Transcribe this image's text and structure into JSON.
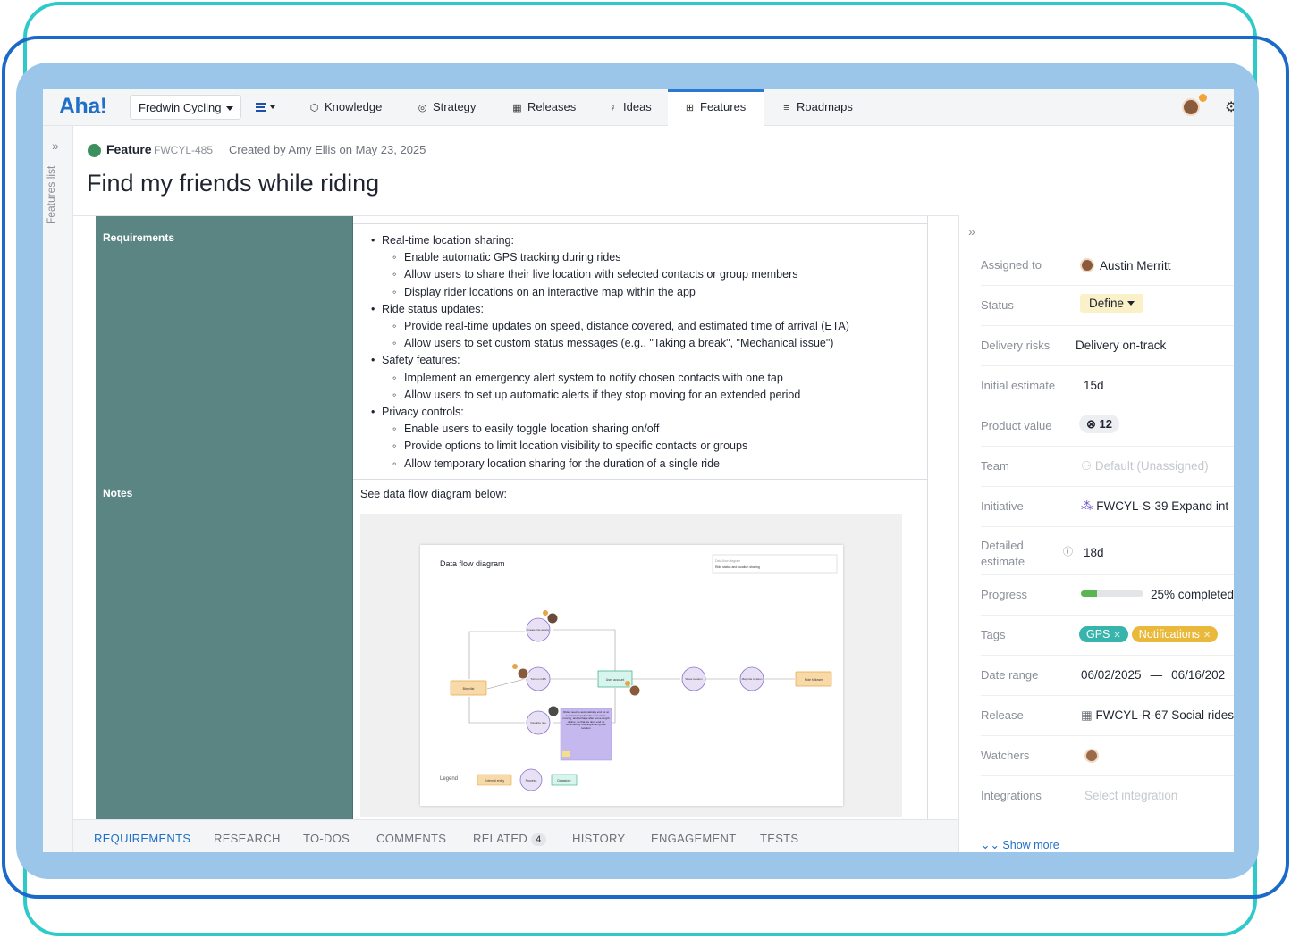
{
  "nav": {
    "logo": "Aha!",
    "workspace": "Fredwin Cycling",
    "items": [
      {
        "label": "Knowledge",
        "icon": "cube-icon"
      },
      {
        "label": "Strategy",
        "icon": "target-icon"
      },
      {
        "label": "Releases",
        "icon": "calendar-icon"
      },
      {
        "label": "Ideas",
        "icon": "lightbulb-icon"
      },
      {
        "label": "Features",
        "icon": "grid-icon"
      },
      {
        "label": "Roadmaps",
        "icon": "roadmap-icon"
      }
    ],
    "active": "Features"
  },
  "left_rail": {
    "label": "Features list"
  },
  "feature": {
    "type_label": "Feature",
    "ref": "FWCYL-485",
    "created": "Created by Amy Ellis on May 23, 2025",
    "title": "Find my friends while riding"
  },
  "requirements": {
    "label": "Requirements",
    "items": [
      {
        "level": "bullet",
        "text": "Real-time location sharing:"
      },
      {
        "level": "sub",
        "text": "Enable automatic GPS tracking during rides"
      },
      {
        "level": "sub",
        "text": "Allow users to share their live location with selected contacts or group members"
      },
      {
        "level": "sub",
        "text": "Display rider locations on an interactive map within the app"
      },
      {
        "level": "bullet",
        "text": "Ride status updates:"
      },
      {
        "level": "sub",
        "text": "Provide real-time updates on speed, distance covered, and estimated time of arrival (ETA)"
      },
      {
        "level": "sub",
        "text": "Allow users to set custom status messages (e.g., \"Taking a break\", \"Mechanical issue\")"
      },
      {
        "level": "bullet",
        "text": "Safety features:"
      },
      {
        "level": "sub",
        "text": "Implement an emergency alert system to notify chosen contacts with one tap"
      },
      {
        "level": "sub",
        "text": "Allow users to set up automatic alerts if they stop moving for an extended period"
      },
      {
        "level": "bullet",
        "text": "Privacy controls:"
      },
      {
        "level": "sub",
        "text": "Enable users to easily toggle location sharing on/off"
      },
      {
        "level": "sub",
        "text": "Provide options to limit location visibility to specific contacts or groups"
      },
      {
        "level": "sub",
        "text": "Allow temporary location sharing for the duration of a single ride"
      }
    ]
  },
  "notes": {
    "label": "Notes",
    "text": "See data flow diagram below:",
    "diagram": {
      "title": "Data flow diagram",
      "info_line1": "Data flow diagram",
      "info_line2": "Ride status and location sharing",
      "nodes": {
        "bicyclist": "Bicyclist",
        "create": "Create ride activity",
        "gps": "Turn on GPS",
        "visualize": "Visualize ride",
        "user_account": "User account",
        "share": "Share location",
        "map": "Map ride location",
        "follower": "Ride follower"
      },
      "note": "Rides need to automatically end (or at least pause) when the user stops moving, and perhaps after some length of time, so that we don't end up continuously tracking/sharing their location",
      "legend_title": "Legend",
      "legend_items": [
        "External entity",
        "Process",
        "Datastore"
      ]
    }
  },
  "tabs": [
    {
      "label": "REQUIREMENTS",
      "active": true
    },
    {
      "label": "RESEARCH"
    },
    {
      "label": "TO-DOS"
    },
    {
      "label": "COMMENTS"
    },
    {
      "label": "RELATED",
      "badge": "4"
    },
    {
      "label": "HISTORY"
    },
    {
      "label": "ENGAGEMENT"
    },
    {
      "label": "TESTS"
    }
  ],
  "panel": {
    "assigned_to": {
      "label": "Assigned to",
      "value": "Austin Merritt"
    },
    "status": {
      "label": "Status",
      "value": "Define"
    },
    "delivery_risks": {
      "label": "Delivery risks",
      "value": "Delivery on-track"
    },
    "initial_estimate": {
      "label": "Initial estimate",
      "value": "15d"
    },
    "product_value": {
      "label": "Product value",
      "value": "12"
    },
    "team": {
      "label": "Team",
      "value": "Default (Unassigned)"
    },
    "initiative": {
      "label": "Initiative",
      "value": "FWCYL-S-39 Expand int"
    },
    "detailed_estimate": {
      "label_1": "Detailed",
      "label_2": "estimate",
      "value": "18d"
    },
    "progress": {
      "label": "Progress",
      "value": "25% completed",
      "fraction": 0.25
    },
    "tags": {
      "label": "Tags",
      "items": [
        "GPS",
        "Notifications"
      ],
      "colors": [
        "#37b5ad",
        "#e9b93b"
      ]
    },
    "date_range": {
      "label": "Date range",
      "start": "06/02/2025",
      "sep": "—",
      "end": "06/16/202"
    },
    "release": {
      "label": "Release",
      "value": "FWCYL-R-67 Social rides"
    },
    "watchers": {
      "label": "Watchers"
    },
    "integrations": {
      "label": "Integrations",
      "value": "Select integration"
    },
    "show_more": "Show more"
  }
}
